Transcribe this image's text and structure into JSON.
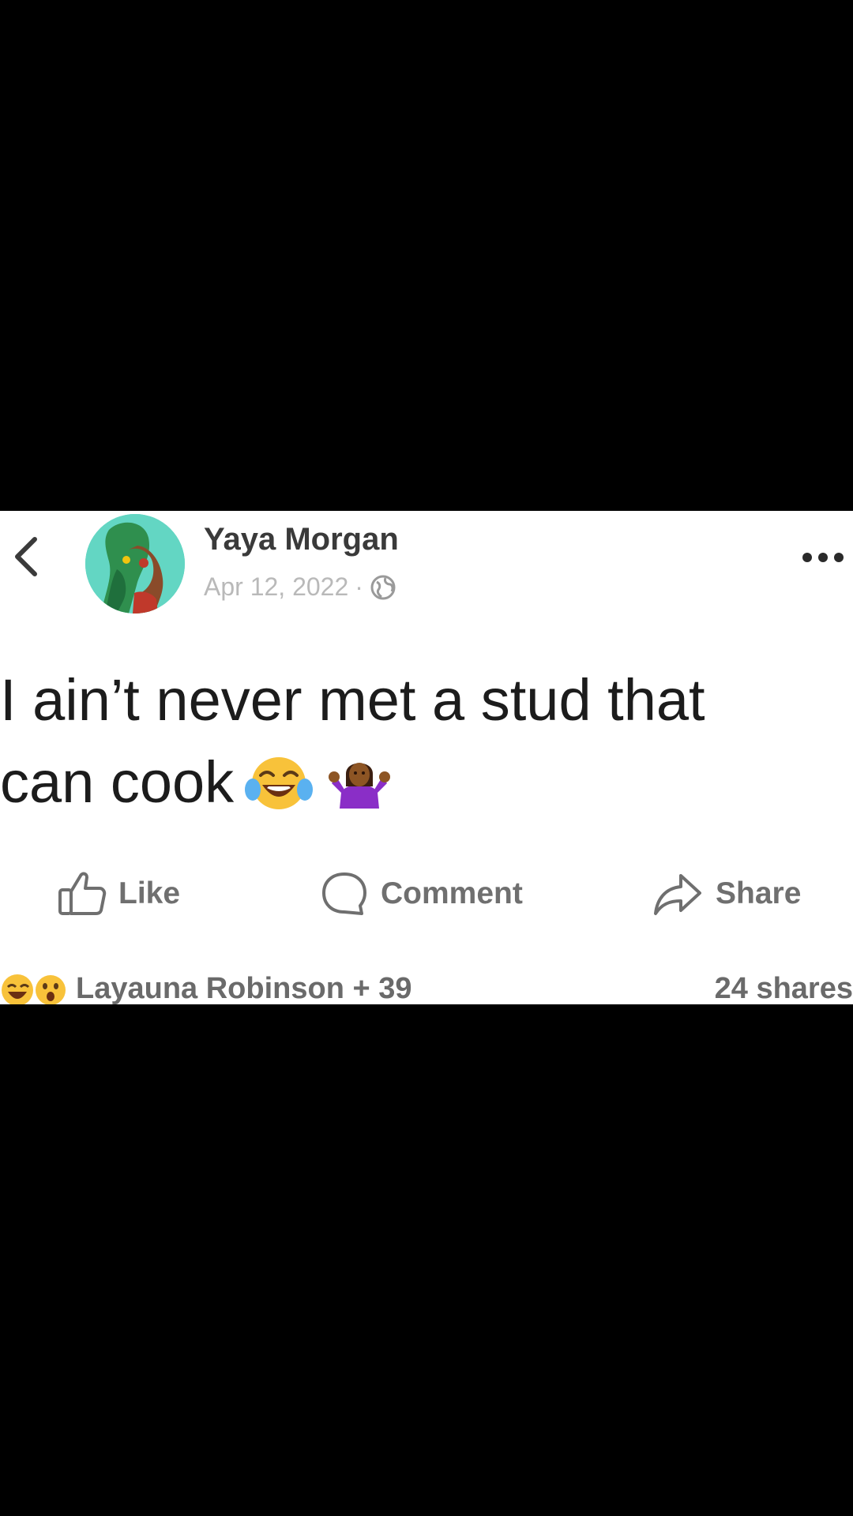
{
  "post": {
    "author": "Yaya Morgan",
    "date": "Apr 12, 2022",
    "separator": "·",
    "text_line1": "I ain’t never met a stud that",
    "text_line2": "can cook"
  },
  "actions": {
    "like_label": "Like",
    "comment_label": "Comment",
    "share_label": "Share"
  },
  "footer": {
    "reactions_text": "Layauna Robinson + 39",
    "shares_text": "24 shares"
  },
  "icons": {
    "back": "chevron-left-icon",
    "more": "more-dots-icon",
    "globe": "globe-icon",
    "like": "thumbs-up-icon",
    "comment": "comment-bubble-icon",
    "share": "share-arrow-icon",
    "emoji1": "laughing-tears-emoji",
    "emoji2": "person-shrugging-emoji"
  },
  "colors": {
    "background": "#000000",
    "card": "#ffffff",
    "text": "#1c1c1c",
    "muted": "#b9b9b9"
  }
}
